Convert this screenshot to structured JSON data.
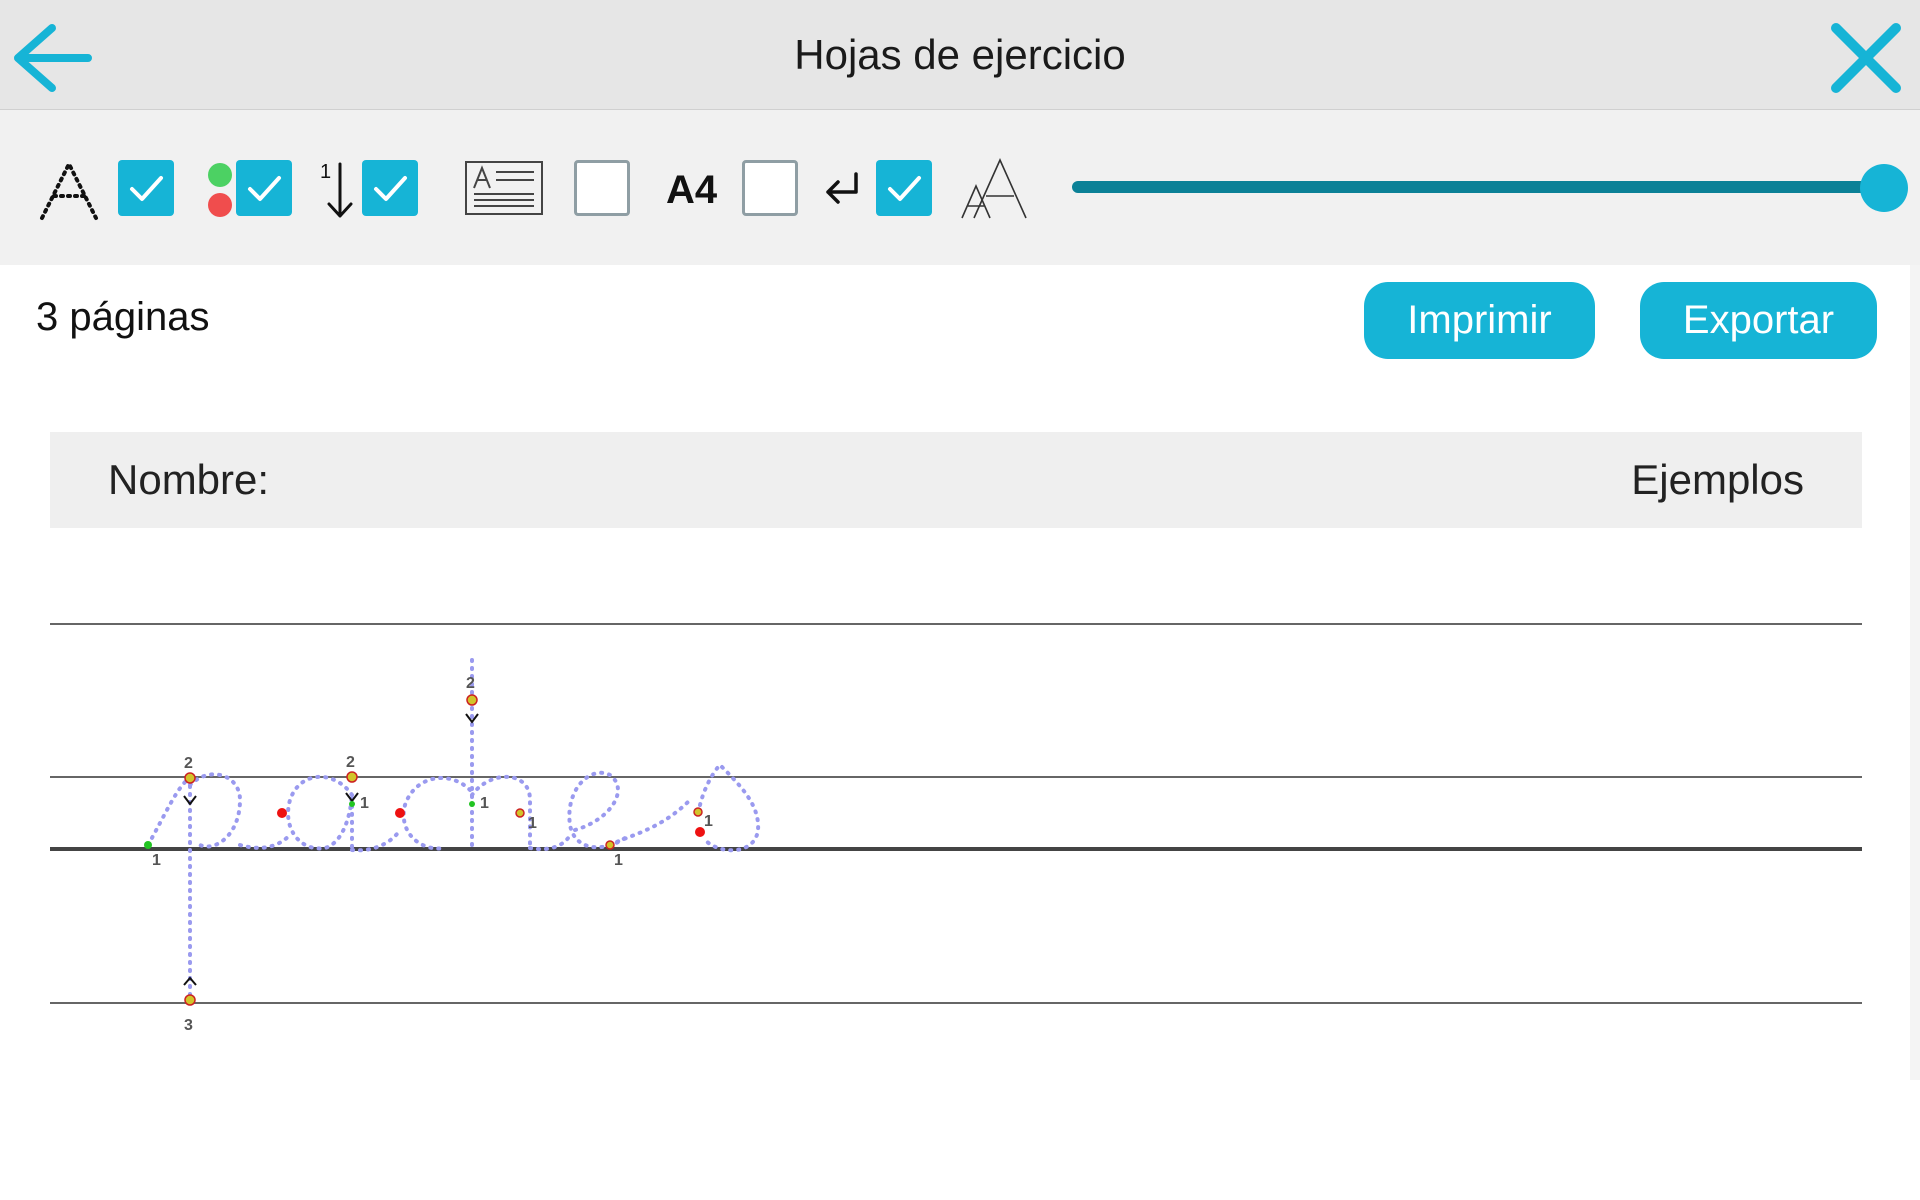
{
  "header": {
    "title": "Hojas de ejercicio",
    "back_icon": "arrow-left-icon",
    "close_icon": "close-icon",
    "accent_color": "#16b4d6"
  },
  "toolbar": {
    "options": [
      {
        "icon": "dotted-letter-icon",
        "checked": true
      },
      {
        "icon": "start-end-dots-icon",
        "checked": true
      },
      {
        "icon": "stroke-order-icon",
        "checked": true
      },
      {
        "icon": "name-field-document-icon",
        "checked": false
      },
      {
        "icon": "paper-size-icon",
        "label": "A4",
        "checked": false
      },
      {
        "icon": "line-break-icon",
        "checked": true
      },
      {
        "icon": "letter-size-icon"
      }
    ],
    "size_slider": {
      "value_fraction": 1.0
    }
  },
  "info": {
    "page_count": "3 páginas"
  },
  "actions": {
    "print_label": "Imprimir",
    "export_label": "Exportar"
  },
  "sheet": {
    "name_label": "Nombre:",
    "examples_label": "Ejemplos",
    "practice_word": "pacher",
    "stroke_numbers": [
      "1",
      "2",
      "3"
    ],
    "start_dot_color": "#22c422",
    "end_dot_color": "#ee1111",
    "trace_color": "#9a9aef"
  }
}
